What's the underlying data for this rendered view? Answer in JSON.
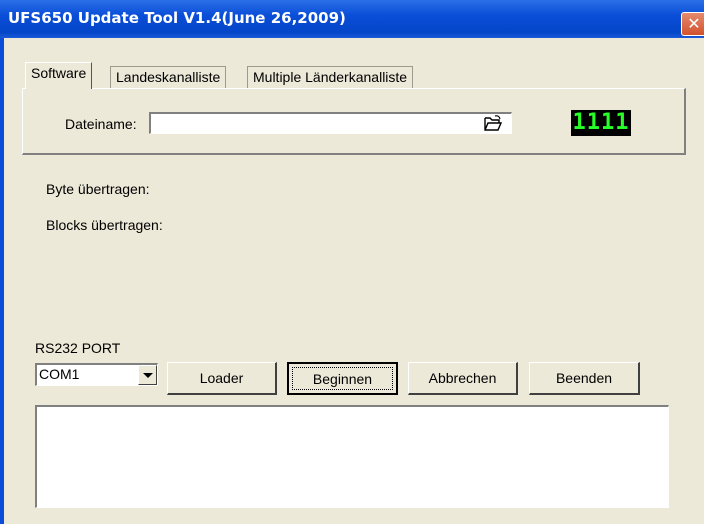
{
  "window": {
    "title": "UFS650 Update Tool V1.4(June 26,2009)",
    "close_glyph": "✕"
  },
  "tabs": [
    {
      "label": "Software",
      "active": true
    },
    {
      "label": "Landeskanalliste",
      "active": false
    },
    {
      "label": "Multiple Länderkanalliste",
      "active": false
    }
  ],
  "file": {
    "label": "Dateiname:",
    "value": "",
    "browse_icon": "folder-open-icon"
  },
  "counter": "1111",
  "status": {
    "bytes_label": "Byte übertragen:",
    "blocks_label": "Blocks übertragen:"
  },
  "port": {
    "label": "RS232 PORT",
    "selected": "COM1"
  },
  "buttons": {
    "loader": "Loader",
    "start": "Beginnen",
    "cancel": "Abbrechen",
    "exit": "Beenden"
  },
  "log": {
    "text": ""
  },
  "colors": {
    "titlebar": "#0a4ed8",
    "window_bg": "#ece9d8",
    "counter_bg": "#000000",
    "counter_fg": "#28ff28"
  }
}
